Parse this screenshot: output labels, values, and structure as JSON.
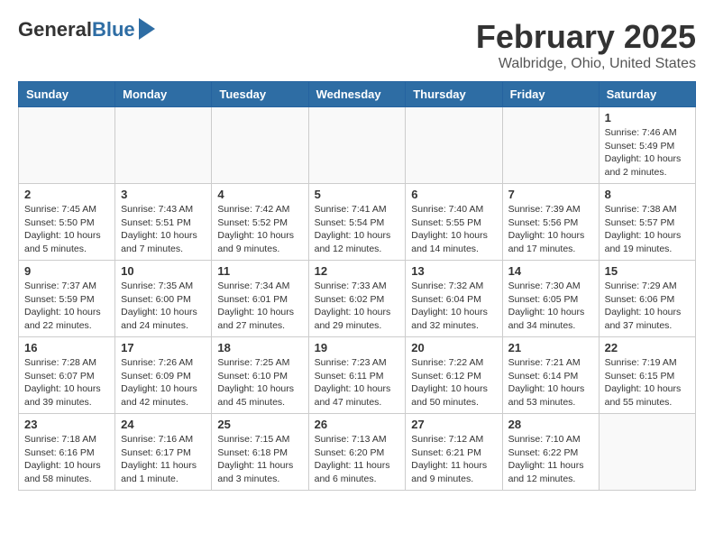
{
  "header": {
    "logo_general": "General",
    "logo_blue": "Blue",
    "month_title": "February 2025",
    "location": "Walbridge, Ohio, United States"
  },
  "calendar": {
    "headers": [
      "Sunday",
      "Monday",
      "Tuesday",
      "Wednesday",
      "Thursday",
      "Friday",
      "Saturday"
    ],
    "weeks": [
      [
        {
          "day": "",
          "info": ""
        },
        {
          "day": "",
          "info": ""
        },
        {
          "day": "",
          "info": ""
        },
        {
          "day": "",
          "info": ""
        },
        {
          "day": "",
          "info": ""
        },
        {
          "day": "",
          "info": ""
        },
        {
          "day": "1",
          "info": "Sunrise: 7:46 AM\nSunset: 5:49 PM\nDaylight: 10 hours and 2 minutes."
        }
      ],
      [
        {
          "day": "2",
          "info": "Sunrise: 7:45 AM\nSunset: 5:50 PM\nDaylight: 10 hours and 5 minutes."
        },
        {
          "day": "3",
          "info": "Sunrise: 7:43 AM\nSunset: 5:51 PM\nDaylight: 10 hours and 7 minutes."
        },
        {
          "day": "4",
          "info": "Sunrise: 7:42 AM\nSunset: 5:52 PM\nDaylight: 10 hours and 9 minutes."
        },
        {
          "day": "5",
          "info": "Sunrise: 7:41 AM\nSunset: 5:54 PM\nDaylight: 10 hours and 12 minutes."
        },
        {
          "day": "6",
          "info": "Sunrise: 7:40 AM\nSunset: 5:55 PM\nDaylight: 10 hours and 14 minutes."
        },
        {
          "day": "7",
          "info": "Sunrise: 7:39 AM\nSunset: 5:56 PM\nDaylight: 10 hours and 17 minutes."
        },
        {
          "day": "8",
          "info": "Sunrise: 7:38 AM\nSunset: 5:57 PM\nDaylight: 10 hours and 19 minutes."
        }
      ],
      [
        {
          "day": "9",
          "info": "Sunrise: 7:37 AM\nSunset: 5:59 PM\nDaylight: 10 hours and 22 minutes."
        },
        {
          "day": "10",
          "info": "Sunrise: 7:35 AM\nSunset: 6:00 PM\nDaylight: 10 hours and 24 minutes."
        },
        {
          "day": "11",
          "info": "Sunrise: 7:34 AM\nSunset: 6:01 PM\nDaylight: 10 hours and 27 minutes."
        },
        {
          "day": "12",
          "info": "Sunrise: 7:33 AM\nSunset: 6:02 PM\nDaylight: 10 hours and 29 minutes."
        },
        {
          "day": "13",
          "info": "Sunrise: 7:32 AM\nSunset: 6:04 PM\nDaylight: 10 hours and 32 minutes."
        },
        {
          "day": "14",
          "info": "Sunrise: 7:30 AM\nSunset: 6:05 PM\nDaylight: 10 hours and 34 minutes."
        },
        {
          "day": "15",
          "info": "Sunrise: 7:29 AM\nSunset: 6:06 PM\nDaylight: 10 hours and 37 minutes."
        }
      ],
      [
        {
          "day": "16",
          "info": "Sunrise: 7:28 AM\nSunset: 6:07 PM\nDaylight: 10 hours and 39 minutes."
        },
        {
          "day": "17",
          "info": "Sunrise: 7:26 AM\nSunset: 6:09 PM\nDaylight: 10 hours and 42 minutes."
        },
        {
          "day": "18",
          "info": "Sunrise: 7:25 AM\nSunset: 6:10 PM\nDaylight: 10 hours and 45 minutes."
        },
        {
          "day": "19",
          "info": "Sunrise: 7:23 AM\nSunset: 6:11 PM\nDaylight: 10 hours and 47 minutes."
        },
        {
          "day": "20",
          "info": "Sunrise: 7:22 AM\nSunset: 6:12 PM\nDaylight: 10 hours and 50 minutes."
        },
        {
          "day": "21",
          "info": "Sunrise: 7:21 AM\nSunset: 6:14 PM\nDaylight: 10 hours and 53 minutes."
        },
        {
          "day": "22",
          "info": "Sunrise: 7:19 AM\nSunset: 6:15 PM\nDaylight: 10 hours and 55 minutes."
        }
      ],
      [
        {
          "day": "23",
          "info": "Sunrise: 7:18 AM\nSunset: 6:16 PM\nDaylight: 10 hours and 58 minutes."
        },
        {
          "day": "24",
          "info": "Sunrise: 7:16 AM\nSunset: 6:17 PM\nDaylight: 11 hours and 1 minute."
        },
        {
          "day": "25",
          "info": "Sunrise: 7:15 AM\nSunset: 6:18 PM\nDaylight: 11 hours and 3 minutes."
        },
        {
          "day": "26",
          "info": "Sunrise: 7:13 AM\nSunset: 6:20 PM\nDaylight: 11 hours and 6 minutes."
        },
        {
          "day": "27",
          "info": "Sunrise: 7:12 AM\nSunset: 6:21 PM\nDaylight: 11 hours and 9 minutes."
        },
        {
          "day": "28",
          "info": "Sunrise: 7:10 AM\nSunset: 6:22 PM\nDaylight: 11 hours and 12 minutes."
        },
        {
          "day": "",
          "info": ""
        }
      ]
    ]
  }
}
